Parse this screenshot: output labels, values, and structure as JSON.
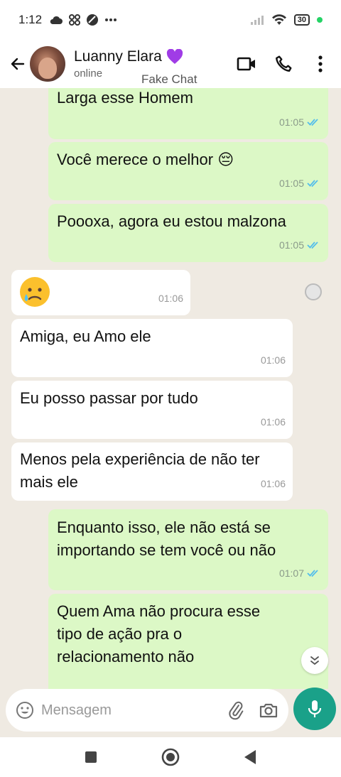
{
  "status_bar": {
    "time": "1:12",
    "battery": "30"
  },
  "header": {
    "contact_name": "Luanny Elara",
    "contact_status": "online",
    "overlay_label": "Fake Chat"
  },
  "messages": [
    {
      "direction": "out",
      "text": "Larga esse Homem",
      "time": "01:05",
      "read": true
    },
    {
      "direction": "out",
      "text": "Você merece o melhor 😔",
      "time": "01:05",
      "read": true
    },
    {
      "direction": "out",
      "text": "Poooxa, agora eu estou malzona",
      "time": "01:05",
      "read": true
    },
    {
      "direction": "in",
      "text": "😥",
      "time": "01:06"
    },
    {
      "direction": "in",
      "text": "Amiga, eu Amo ele",
      "time": "01:06"
    },
    {
      "direction": "in",
      "text": "Eu posso passar por tudo",
      "time": "01:06"
    },
    {
      "direction": "in",
      "text": "Menos pela experiência de não ter mais ele",
      "time": "01:06"
    },
    {
      "direction": "out",
      "text": "Enquanto isso, ele não está se importando se tem você ou não",
      "time": "01:07",
      "read": true
    },
    {
      "direction": "out",
      "text": "Quem Ama não procura esse tipo de ação pra o relacionamento não"
    }
  ],
  "composer": {
    "placeholder": "Mensagem"
  },
  "colors": {
    "outgoing_bubble": "#dcf8c6",
    "incoming_bubble": "#ffffff",
    "chat_background": "#efeae2",
    "accent": "#1aa189",
    "read_ticks": "#53bdeb"
  }
}
